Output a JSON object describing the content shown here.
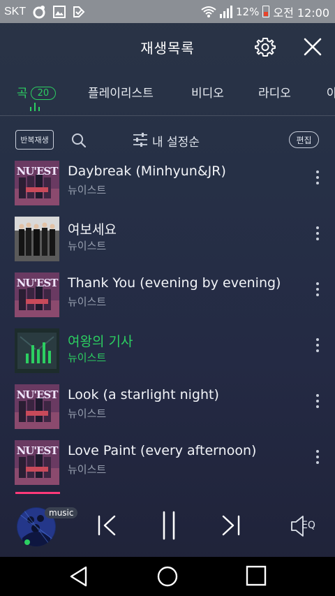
{
  "status_bar": {
    "carrier": "SKT",
    "battery_percent": "12%",
    "time": "오전 12:00"
  },
  "header": {
    "title": "재생목록"
  },
  "tabs": [
    {
      "label": "곡",
      "badge": "20",
      "active": true
    },
    {
      "label": "플레이리스트",
      "active": false
    },
    {
      "label": "비디오",
      "active": false
    },
    {
      "label": "라디오",
      "active": false
    },
    {
      "label": "아",
      "active": false
    }
  ],
  "toolbar": {
    "repeat_label": "반복재생",
    "sort_label": "내 설정순",
    "edit_label": "편집"
  },
  "songs": [
    {
      "title": "Daybreak (Minhyun&JR)",
      "artist": "뉴이스트",
      "playing": false,
      "art": "nuest-album"
    },
    {
      "title": "여보세요",
      "artist": "뉴이스트",
      "playing": false,
      "art": "group-photo"
    },
    {
      "title": "Thank You (evening by evening)",
      "artist": "뉴이스트",
      "playing": false,
      "art": "nuest-album"
    },
    {
      "title": "여왕의 기사",
      "artist": "뉴이스트",
      "playing": true,
      "art": "playing-eq"
    },
    {
      "title": "Look (a starlight night)",
      "artist": "뉴이스트",
      "playing": false,
      "art": "nuest-album"
    },
    {
      "title": "Love Paint (every afternoon)",
      "artist": "뉴이스트",
      "playing": false,
      "art": "nuest-album"
    }
  ],
  "player": {
    "badge": "music",
    "eq_label": "EQ"
  },
  "colors": {
    "accent": "#2ccf61",
    "progress": "#ff3a7a"
  }
}
